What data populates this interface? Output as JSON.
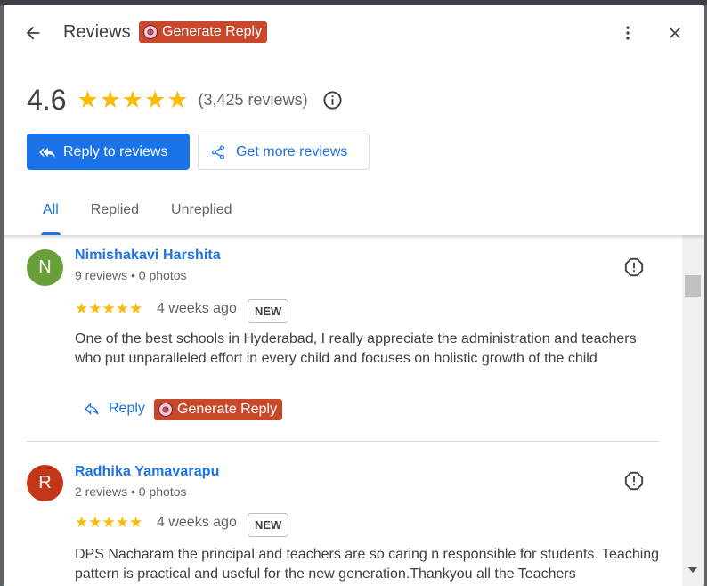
{
  "header": {
    "title": "Reviews",
    "generate_reply_badge": "Generate Reply"
  },
  "summary": {
    "rating": "4.6",
    "stars": "★★★★★",
    "review_count": "(3,425 reviews)"
  },
  "actions": {
    "reply_to_reviews": "Reply to reviews",
    "get_more_reviews": "Get more reviews"
  },
  "tabs": [
    {
      "label": "All",
      "active": true
    },
    {
      "label": "Replied",
      "active": false
    },
    {
      "label": "Unreplied",
      "active": false
    }
  ],
  "reviews": [
    {
      "initial": "N",
      "avatar_color": "#689f38",
      "name": "Nimishakavi Harshita",
      "meta": "9 reviews • 0 photos",
      "stars": "★★★★★",
      "time_ago": "4 weeks ago",
      "badge": "NEW",
      "text": "One of the best schools in Hyderabad, I really appreciate the administration and teachers who put unparalleled effort in every child and focuses on holistic growth of the child",
      "reply_label": "Reply",
      "generate_reply_label": "Generate Reply"
    },
    {
      "initial": "R",
      "avatar_color": "#c3361a",
      "name": "Radhika Yamavarapu",
      "meta": "2 reviews • 0 photos",
      "stars": "★★★★★",
      "time_ago": "4 weeks ago",
      "badge": "NEW",
      "text": "DPS Nacharam the principal and teachers are so caring n responsible for students. Teaching pattern is practical and useful for the new generation.Thankyou all the Teachers"
    }
  ],
  "colors": {
    "accent": "#1a73e8",
    "star": "#fbbc04",
    "generate_badge": "#c9482b"
  },
  "icons": [
    "back-arrow-icon",
    "brain-icon",
    "more-vert-icon",
    "close-icon",
    "star-icon",
    "info-icon",
    "reply-icon",
    "share-icon",
    "flag-icon"
  ]
}
